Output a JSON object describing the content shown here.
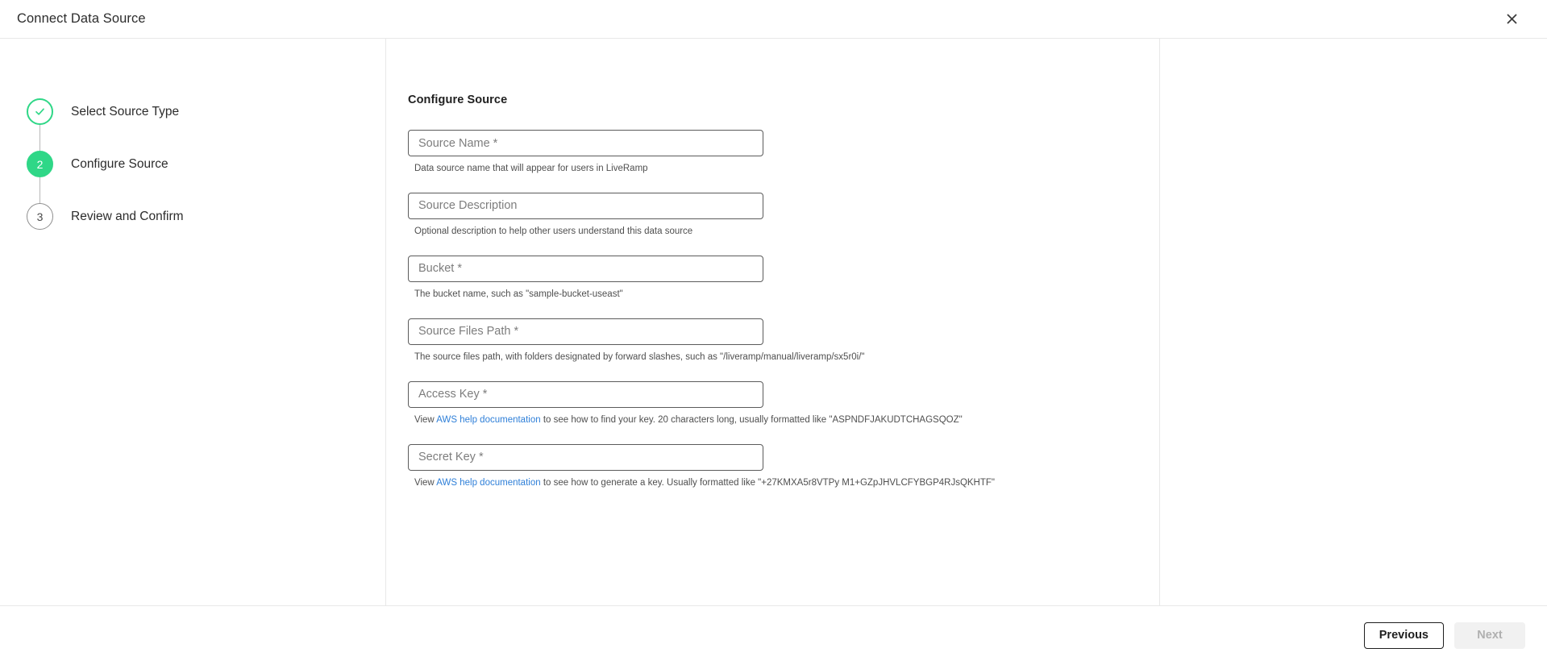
{
  "header": {
    "title": "Connect Data Source",
    "close_icon": "close-icon"
  },
  "stepper": {
    "steps": [
      {
        "marker": "✓",
        "label": "Select Source Type",
        "state": "done"
      },
      {
        "marker": "2",
        "label": "Configure Source",
        "state": "current"
      },
      {
        "marker": "3",
        "label": "Review and Confirm",
        "state": "todo"
      }
    ]
  },
  "form": {
    "heading": "Configure Source",
    "fields": [
      {
        "name": "source-name",
        "placeholder": "Source Name *",
        "value": "",
        "help_prefix": "Data source name that will appear for users in LiveRamp",
        "link_text": "",
        "help_suffix": ""
      },
      {
        "name": "source-description",
        "placeholder": "Source Description",
        "value": "",
        "help_prefix": "Optional description to help other users understand this data source",
        "link_text": "",
        "help_suffix": ""
      },
      {
        "name": "bucket",
        "placeholder": "Bucket *",
        "value": "",
        "help_prefix": "The bucket name, such as \"sample-bucket-useast\"",
        "link_text": "",
        "help_suffix": ""
      },
      {
        "name": "source-files-path",
        "placeholder": "Source Files Path *",
        "value": "",
        "help_prefix": "The source files path, with folders designated by forward slashes, such as \"/liveramp/manual/liveramp/sx5r0i/\"",
        "link_text": "",
        "help_suffix": ""
      },
      {
        "name": "access-key",
        "placeholder": "Access Key *",
        "value": "",
        "help_prefix": "View ",
        "link_text": "AWS help documentation",
        "help_suffix": " to see how to find your key. 20 characters long, usually formatted like \"ASPNDFJAKUDTCHAGSQOZ\""
      },
      {
        "name": "secret-key",
        "placeholder": "Secret Key *",
        "value": "",
        "help_prefix": "View ",
        "link_text": "AWS help documentation",
        "help_suffix": " to see how to generate a key. Usually formatted like \"+27KMXA5r8VTPy M1+GZpJHVLCFYBGP4RJsQKHTF\""
      }
    ]
  },
  "footer": {
    "previous_label": "Previous",
    "next_label": "Next"
  },
  "colors": {
    "accent_green": "#2fd787",
    "link_blue": "#2e7fd8",
    "border_gray": "#e8e8e8",
    "input_border": "#5b5b5b"
  }
}
